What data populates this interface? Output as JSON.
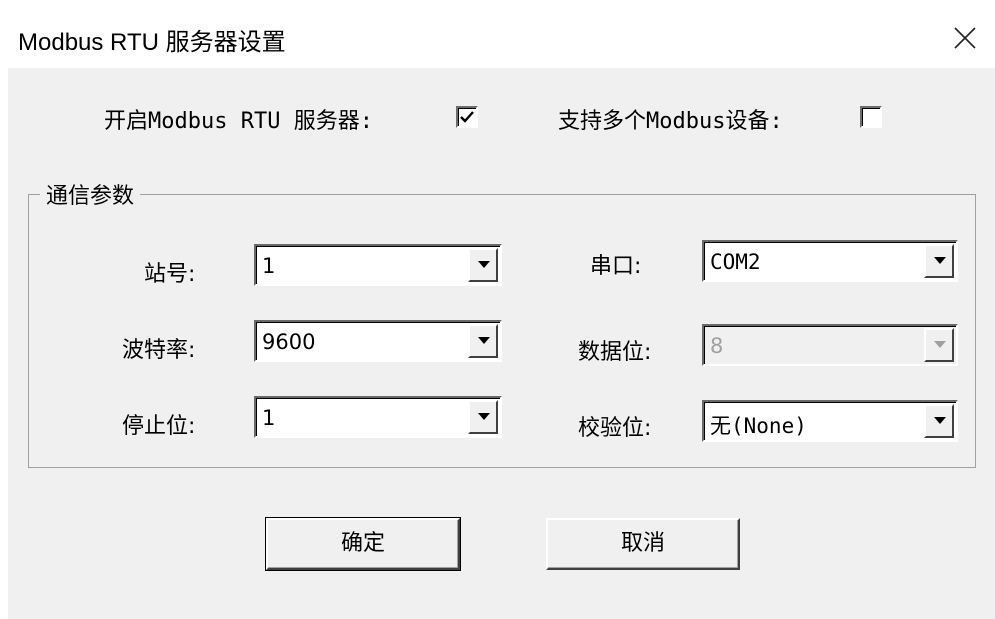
{
  "window": {
    "title": "Modbus RTU 服务器设置",
    "close_icon": "close-icon"
  },
  "options": {
    "enable_server_label": "开启Modbus RTU 服务器:",
    "enable_server_checked": true,
    "multi_device_label": "支持多个Modbus设备:",
    "multi_device_checked": false
  },
  "comm": {
    "group_title": "通信参数",
    "station_label": "站号:",
    "station_value": "1",
    "baud_label": "波特率:",
    "baud_value": "9600",
    "stop_label": "停止位:",
    "stop_value": "1",
    "port_label": "串口:",
    "port_value": "COM2",
    "data_bits_label": "数据位:",
    "data_bits_value": "8",
    "data_bits_enabled": false,
    "parity_label": "校验位:",
    "parity_value": "无(None)"
  },
  "buttons": {
    "ok_label": "确定",
    "cancel_label": "取消"
  },
  "colors": {
    "dialog_bg": "#f0f0f0",
    "title_bg": "#ffffff",
    "disabled_text": "#a0a0a0"
  }
}
